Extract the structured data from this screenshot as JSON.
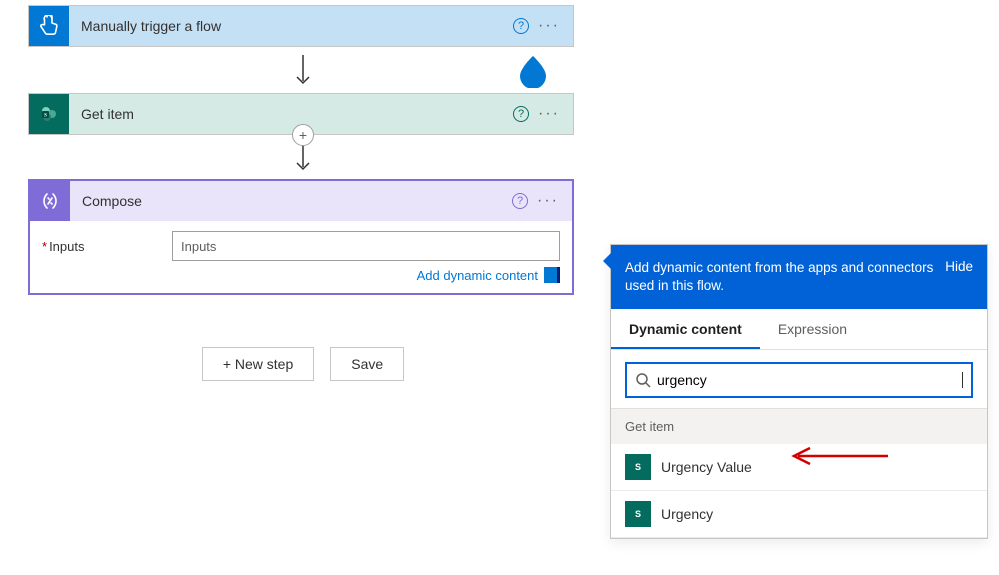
{
  "flow": {
    "trigger": {
      "title": "Manually trigger a flow"
    },
    "getitem": {
      "title": "Get item"
    },
    "compose": {
      "title": "Compose",
      "inputs_label": "Inputs",
      "inputs_placeholder": "Inputs",
      "add_dynamic_label": "Add dynamic content"
    }
  },
  "buttons": {
    "new_step": "+ New step",
    "save": "Save"
  },
  "dyn": {
    "header": "Add dynamic content from the apps and connectors used in this flow.",
    "hide": "Hide",
    "tab_dynamic": "Dynamic content",
    "tab_expression": "Expression",
    "search_value": "urgency",
    "group_label": "Get item",
    "items": [
      {
        "label": "Urgency Value"
      },
      {
        "label": "Urgency"
      }
    ]
  }
}
